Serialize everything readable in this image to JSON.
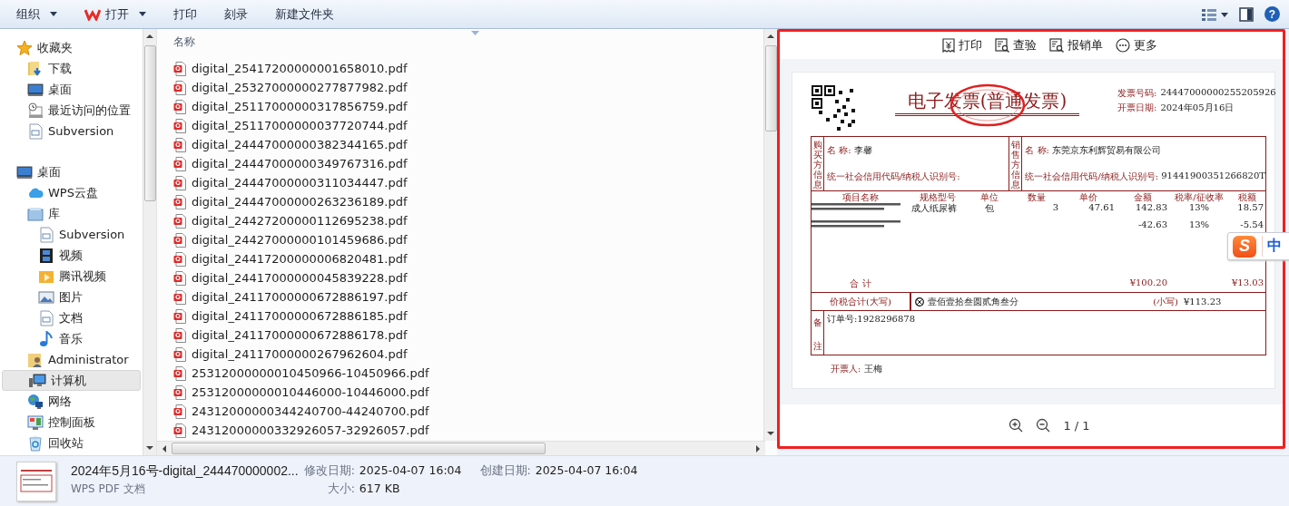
{
  "toolbar": {
    "buttons": [
      {
        "label": "组织",
        "kind": "dropdown"
      },
      {
        "label": "打开",
        "kind": "app-dropdown"
      },
      {
        "label": "打印",
        "kind": "plain"
      },
      {
        "label": "刻录",
        "kind": "plain"
      },
      {
        "label": "新建文件夹",
        "kind": "plain"
      }
    ],
    "help": "?"
  },
  "sidebar": {
    "sections": [
      {
        "label": "收藏夹",
        "kind": "star",
        "selected": false,
        "children": [
          {
            "label": "下载",
            "kind": "download",
            "selected": false
          },
          {
            "label": "桌面",
            "kind": "desktop",
            "selected": false
          },
          {
            "label": "最近访问的位置",
            "kind": "recent",
            "selected": false
          },
          {
            "label": "Subversion",
            "kind": "doc",
            "selected": false
          }
        ]
      },
      {
        "label": "桌面",
        "kind": "desktop",
        "selected": false,
        "children": [
          {
            "label": "WPS云盘",
            "kind": "cloud",
            "selected": false
          },
          {
            "label": "库",
            "kind": "library",
            "selected": false,
            "children": [
              {
                "label": "Subversion",
                "kind": "doc",
                "selected": false
              },
              {
                "label": "视频",
                "kind": "film",
                "selected": false
              },
              {
                "label": "腾讯视频",
                "kind": "videofolder",
                "selected": false
              },
              {
                "label": "图片",
                "kind": "picture",
                "selected": false
              },
              {
                "label": "文档",
                "kind": "doc",
                "selected": false
              },
              {
                "label": "音乐",
                "kind": "music",
                "selected": false
              }
            ]
          },
          {
            "label": "Administrator",
            "kind": "user",
            "selected": false
          },
          {
            "label": "计算机",
            "kind": "computer",
            "selected": true
          },
          {
            "label": "网络",
            "kind": "network",
            "selected": false
          },
          {
            "label": "控制面板",
            "kind": "panel",
            "selected": false
          },
          {
            "label": "回收站",
            "kind": "bin",
            "selected": false
          }
        ]
      }
    ]
  },
  "file_list": {
    "column": "名称",
    "files": [
      "digital_25417200000001658010.pdf",
      "digital_25327000000277877982.pdf",
      "digital_25117000000317856759.pdf",
      "digital_25117000000037720744.pdf",
      "digital_24447000000382344165.pdf",
      "digital_24447000000349767316.pdf",
      "digital_24447000000311034447.pdf",
      "digital_24447000000263236189.pdf",
      "digital_24427200000112695238.pdf",
      "digital_24427000000101459686.pdf",
      "digital_24417200000006820481.pdf",
      "digital_24417000000045839228.pdf",
      "digital_24117000000672886197.pdf",
      "digital_24117000000672886185.pdf",
      "digital_24117000000672886178.pdf",
      "digital_24117000000267962604.pdf",
      "25312000000010450966-10450966.pdf",
      "25312000000010446000-10446000.pdf",
      "24312000000344240700-44240700.pdf",
      "24312000000332926057-32926057.pdf"
    ]
  },
  "preview": {
    "actions": [
      {
        "label": "打印",
        "kind": "print"
      },
      {
        "label": "查验",
        "kind": "verify"
      },
      {
        "label": "报销单",
        "kind": "verify"
      },
      {
        "label": "更多",
        "kind": "more"
      }
    ],
    "invoice": {
      "title": "电子发票(普通发票)",
      "fields": [
        {
          "label": "发票号码:",
          "value": "24447000000255205926"
        },
        {
          "label": "开票日期:",
          "value": "2024年05月16日"
        }
      ],
      "buyer": {
        "heading": "购买方信息",
        "name_label": "名 称:",
        "name": "李馨",
        "id_label": "统一社会信用代码/纳税人识别号:"
      },
      "seller": {
        "heading": "销售方信息",
        "name_label": "名 称:",
        "name": "东莞京东利辉贸易有限公司",
        "id_label": "统一社会信用代码/纳税人识别号:",
        "id": "91441900351266820T"
      },
      "columns": [
        "项目名称",
        "规格型号",
        "单位",
        "数量",
        "单价",
        "金额",
        "税率/征收率",
        "税额"
      ],
      "rows": [
        {
          "spec": "成人纸尿裤",
          "unit": "包",
          "qty": "3",
          "price": "47.61",
          "amount": "142.83",
          "rate": "13%",
          "tax": "18.57"
        },
        {
          "amount": "-42.63",
          "rate": "13%",
          "tax": "-5.54"
        }
      ],
      "total": {
        "label": "合 计",
        "amount": "¥100.20",
        "tax": "¥13.03"
      },
      "grand_total": {
        "label": "价税合计(大写)",
        "words": "壹佰壹拾叁圆贰角叁分",
        "small_label": "(小写)",
        "value": "¥113.23"
      },
      "remarks": {
        "heading": "备注",
        "text": "订单号:1928296878"
      },
      "issuer": {
        "label": "开票人:",
        "name": "王梅"
      }
    },
    "pager": "1 / 1"
  },
  "ime": {
    "logo": "S",
    "mode": "中"
  },
  "status_bar": {
    "name": "2024年5月16号-digital_244470000002...",
    "type": "WPS PDF 文档",
    "modified_label": "修改日期:",
    "modified": "2025-04-07 16:04",
    "created_label": "创建日期:",
    "created": "2025-04-07 16:04",
    "size_label": "大小:",
    "size": "617 KB"
  }
}
